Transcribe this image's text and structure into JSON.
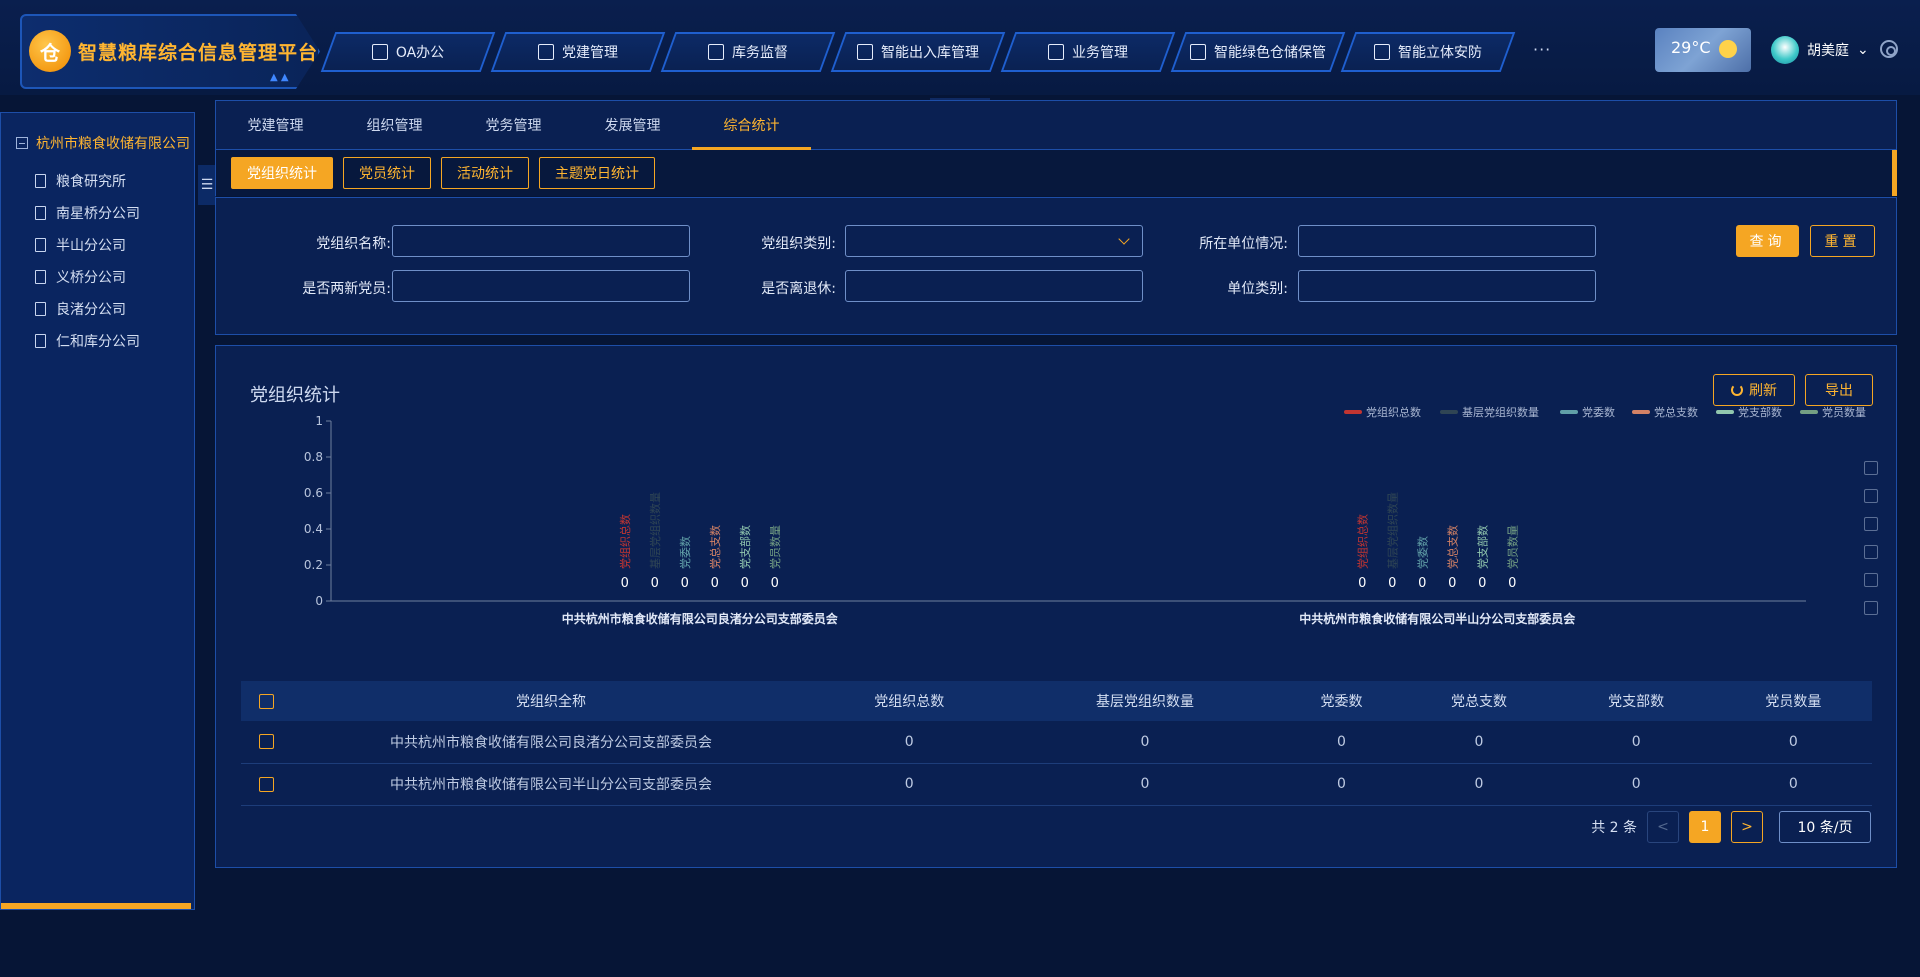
{
  "app": {
    "title": "智慧粮库综合信息管理平台",
    "logo_glyph": "仓"
  },
  "nav": {
    "items": [
      {
        "label": "OA办公",
        "icon": "bag-icon"
      },
      {
        "label": "党建管理",
        "icon": "document-shield-icon"
      },
      {
        "label": "库务监督",
        "icon": "line-chart-icon"
      },
      {
        "label": "智能出入库管理",
        "icon": "exchange-icon"
      },
      {
        "label": "业务管理",
        "icon": "book-icon"
      },
      {
        "label": "智能绿色仓储保管",
        "icon": "monitor-icon"
      },
      {
        "label": "智能立体安防",
        "icon": "alarm-icon"
      }
    ],
    "more": "···"
  },
  "weather": {
    "temp": "29°C",
    "icon": "partly-cloudy-icon"
  },
  "user": {
    "name": "胡美庭",
    "chevron": "⌄"
  },
  "sidebar": {
    "root": "杭州市粮食收储有限公司",
    "items": [
      "粮食研究所",
      "南星桥分公司",
      "半山分公司",
      "义桥分公司",
      "良渚分公司",
      "仁和库分公司"
    ]
  },
  "tabs": [
    "党建管理",
    "组织管理",
    "党务管理",
    "发展管理",
    "综合统计"
  ],
  "active_tab": "综合统计",
  "subtabs": [
    "党组织统计",
    "党员统计",
    "活动统计",
    "主题党日统计"
  ],
  "filters": {
    "org_name_label": "党组织名称:",
    "org_type_label": "党组织类别:",
    "unit_status_label": "所在单位情况:",
    "two_new_label": "是否两新党员:",
    "retired_label": "是否离退休:",
    "unit_type_label": "单位类别:",
    "query_btn": "查询",
    "reset_btn": "重置"
  },
  "panel": {
    "title": "党组织统计",
    "refresh_btn": "刷新",
    "export_btn": "导出"
  },
  "colors": {
    "accent": "#f5a623",
    "series": [
      "#c23531",
      "#2f4554",
      "#61a0a8",
      "#d48265",
      "#91c7ae",
      "#749f83"
    ]
  },
  "chart_data": {
    "type": "bar",
    "categories": [
      "中共杭州市粮食收储有限公司良渚分公司支部委员会",
      "中共杭州市粮食收储有限公司半山分公司支部委员会"
    ],
    "series": [
      {
        "name": "党组织总数",
        "values": [
          0,
          0
        ]
      },
      {
        "name": "基层党组织数量",
        "values": [
          0,
          0
        ]
      },
      {
        "name": "党委数",
        "values": [
          0,
          0
        ]
      },
      {
        "name": "党总支数",
        "values": [
          0,
          0
        ]
      },
      {
        "name": "党支部数",
        "values": [
          0,
          0
        ]
      },
      {
        "name": "党员数量",
        "values": [
          0,
          0
        ]
      }
    ],
    "yticks": [
      "0",
      "0.2",
      "0.4",
      "0.6",
      "0.8",
      "1"
    ],
    "ylim": [
      0,
      1
    ],
    "legend": "top-right",
    "grid": false
  },
  "table": {
    "columns": [
      "党组织全称",
      "党组织总数",
      "基层党组织数量",
      "党委数",
      "党总支数",
      "党支部数",
      "党员数量"
    ],
    "rows": [
      [
        "中共杭州市粮食收储有限公司良渚分公司支部委员会",
        "0",
        "0",
        "0",
        "0",
        "0",
        "0"
      ],
      [
        "中共杭州市粮食收储有限公司半山分公司支部委员会",
        "0",
        "0",
        "0",
        "0",
        "0",
        "0"
      ]
    ]
  },
  "pager": {
    "total": "共 2 条",
    "prev": "<",
    "current": "1",
    "next": ">",
    "page_size": "10 条/页"
  }
}
